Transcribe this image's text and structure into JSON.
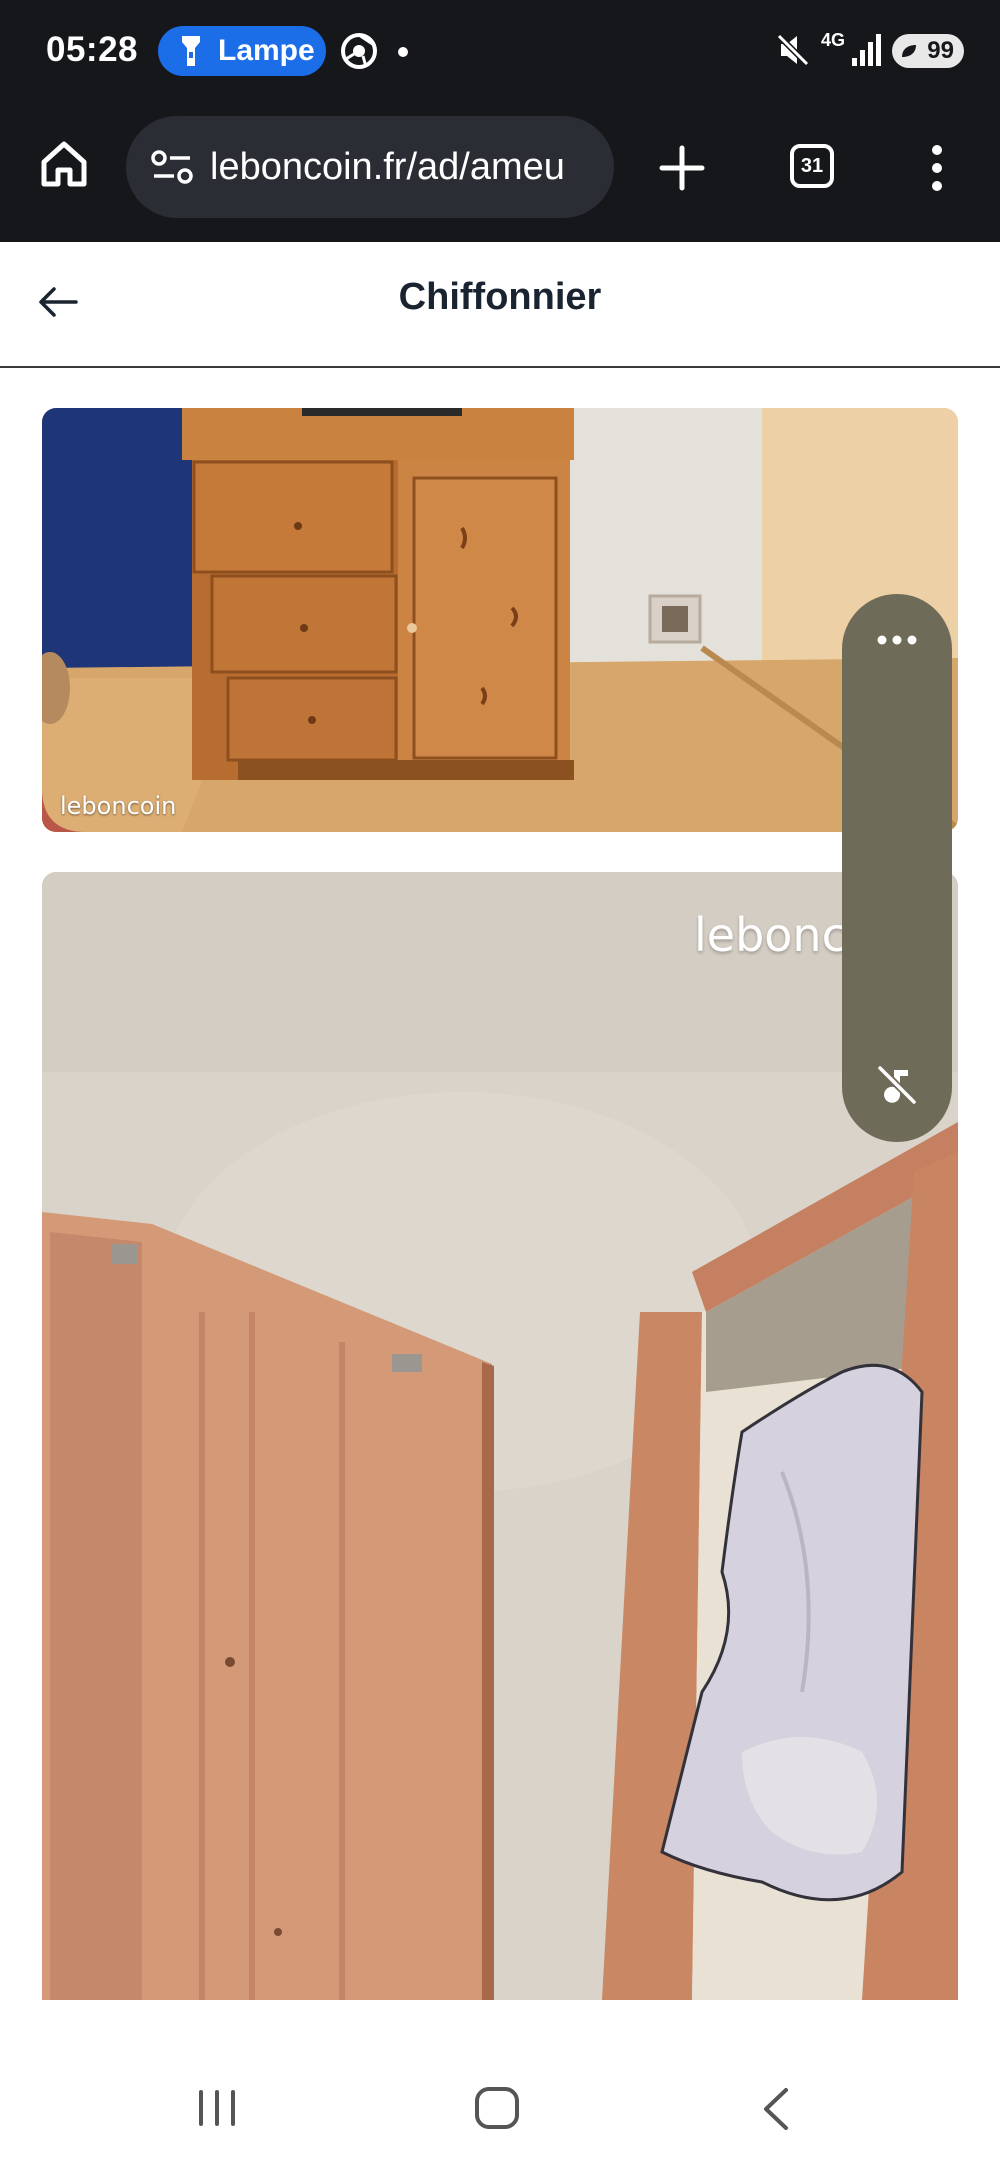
{
  "status_bar": {
    "time": "05:28",
    "flashlight_label": "Lampe",
    "network": "4G",
    "battery": "99"
  },
  "browser": {
    "url": "leboncoin.fr/ad/ameu",
    "tab_count": "31"
  },
  "page": {
    "title": "Chiffonnier"
  },
  "gallery": {
    "watermark_1": "leboncoin",
    "watermark_2": "lebonc"
  },
  "colors": {
    "status_bg": "#15171b",
    "pill_accent": "#1c6ee8",
    "float_pill": "#6f6b59"
  },
  "icons": [
    "home-icon",
    "site-settings-icon",
    "plus-icon",
    "menu-icon",
    "back-arrow-icon",
    "more-icon",
    "music-off-icon",
    "recent-apps-icon",
    "nav-home-icon",
    "nav-back-icon"
  ]
}
